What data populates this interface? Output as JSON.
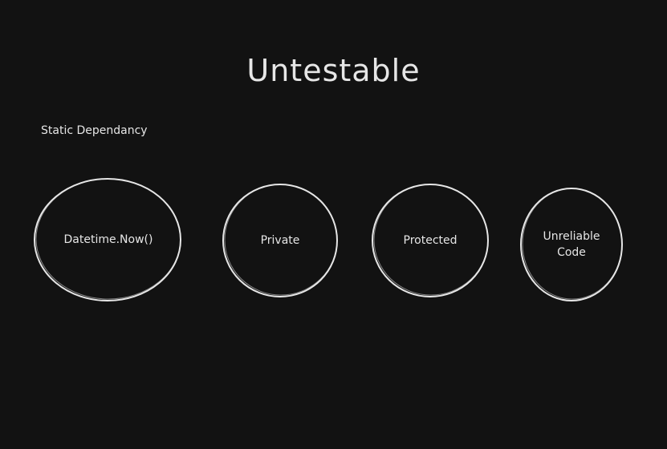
{
  "title": "Untestable",
  "label": "Static Dependancy",
  "nodes": [
    {
      "text": "Datetime.Now()"
    },
    {
      "text": "Private"
    },
    {
      "text": "Protected"
    },
    {
      "text": "Unreliable\nCode"
    }
  ],
  "colors": {
    "background": "#121212",
    "stroke": "#e6e6e6"
  }
}
